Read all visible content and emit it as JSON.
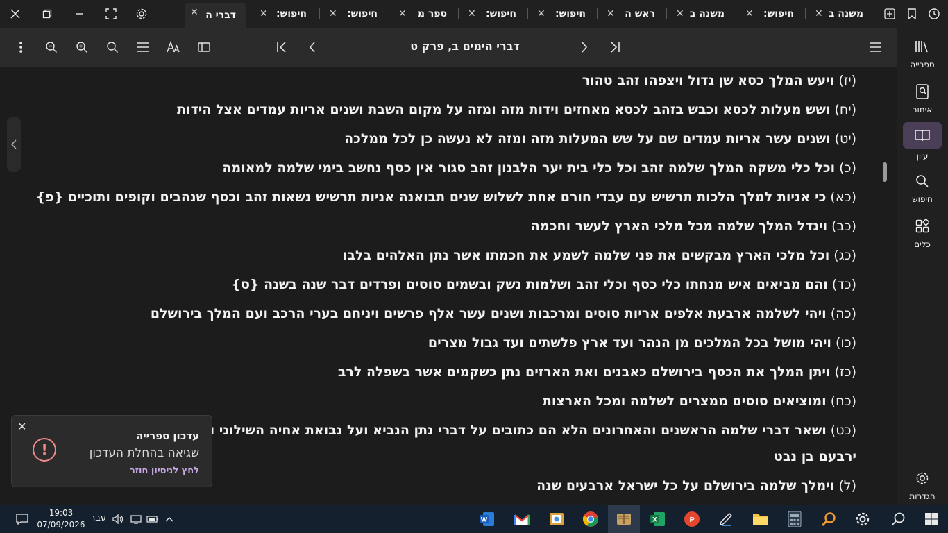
{
  "tabs": [
    {
      "label": "דברי ה",
      "active": true
    },
    {
      "label": "חיפוש:",
      "active": false
    },
    {
      "label": "חיפוש:",
      "active": false
    },
    {
      "label": "ספר מ",
      "active": false
    },
    {
      "label": "חיפוש:",
      "active": false
    },
    {
      "label": "חיפוש:",
      "active": false
    },
    {
      "label": "ראש ה",
      "active": false
    },
    {
      "label": "משנה ב",
      "active": false
    },
    {
      "label": "חיפוש:",
      "active": false
    },
    {
      "label": "משנה ב",
      "active": false
    }
  ],
  "toolbar": {
    "title": "דברי הימים ב, פרק ט"
  },
  "verses": [
    {
      "num": "(יז)",
      "text": "ויעש המלך כסא שן גדול ויצפהו זהב טהור"
    },
    {
      "num": "(יח)",
      "text": "ושש מעלות לכסא וכבש בזהב לכסא מאחזים וידות מזה ומזה על מקום השבת ושנים אריות עמדים אצל הידות"
    },
    {
      "num": "(יט)",
      "text": "ושנים עשר אריות עמדים שם על שש המעלות מזה ומזה לא נעשה כן לכל ממלכה"
    },
    {
      "num": "(כ)",
      "text": "וכל כלי משקה המלך שלמה זהב וכל כלי בית יער הלבנון זהב סגור אין כסף נחשב בימי שלמה למאומה"
    },
    {
      "num": "(כא)",
      "text": "כי אניות למלך הלכות תרשיש עם עבדי חורם אחת לשלוש שנים תבואנה  אניות תרשיש נשאות זהב וכסף שנהבים וקופים ותוכיים {פ}"
    },
    {
      "num": "(כב)",
      "text": "ויגדל המלך שלמה מכל מלכי הארץ לעשר וחכמה"
    },
    {
      "num": "(כג)",
      "text": "וכל מלכי הארץ מבקשים את פני שלמה לשמע את חכמתו אשר נתן האלהים בלבו"
    },
    {
      "num": "(כד)",
      "text": "והם מביאים איש מנחתו כלי כסף וכלי זהב ושלמות נשק ובשמים סוסים ופרדים דבר שנה בשנה {ס}"
    },
    {
      "num": "(כה)",
      "text": "ויהי לשלמה ארבעת אלפים אריות סוסים ומרכבות ושנים עשר אלף פרשים ויניחם בערי הרכב ועם המלך בירושלם"
    },
    {
      "num": "(כו)",
      "text": "ויהי מושל בכל המלכים מן הנהר ועד ארץ פלשתים ועד גבול מצרים"
    },
    {
      "num": "(כז)",
      "text": "ויתן המלך את הכסף בירושלם כאבנים ואת הארזים נתן כשקמים אשר בשפלה לרב"
    },
    {
      "num": "(כח)",
      "text": "ומוציאים סוסים ממצרים לשלמה ומכל הארצות"
    },
    {
      "num": "(כט)",
      "text": "ושאר דברי שלמה הראשנים והאחרונים הלא הם כתובים על דברי נתן הנביא ועל נבואת אחיה השילוני ובחזות (יעדי) [יעדו] החזה על"
    },
    {
      "num": "",
      "text": "ירבעם בן נבט"
    },
    {
      "num": "(ל)",
      "text": "וימלך שלמה בירושלם על כל ישראל ארבעים שנה"
    }
  ],
  "nav": [
    {
      "label": "ספרייה",
      "icon": "library-icon"
    },
    {
      "label": "איתור",
      "icon": "locate-icon"
    },
    {
      "label": "עיון",
      "icon": "book-open-icon",
      "active": true
    },
    {
      "label": "חיפוש",
      "icon": "search-icon"
    },
    {
      "label": "כלים",
      "icon": "tools-icon"
    },
    {
      "label": "הגדרות",
      "icon": "gear-icon"
    }
  ],
  "toast": {
    "title": "עדכון ספרייה",
    "message": "שגיאה בהחלת העדכון",
    "action": "לחץ לניסיון חוזר"
  },
  "taskbar": {
    "time": "19:03",
    "date": "07/09/2026",
    "language": "עבר"
  },
  "colors": {
    "accent": "#4b3f57",
    "error": "#f08a8a",
    "link": "#c8a8e8"
  }
}
